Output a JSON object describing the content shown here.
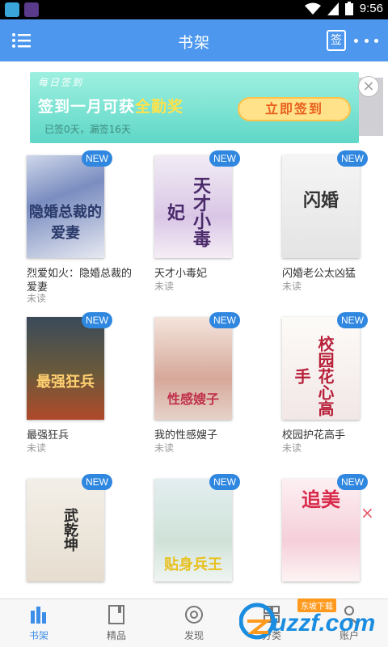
{
  "status_bar": {
    "time": "9:56"
  },
  "header": {
    "title": "书架",
    "sign_icon_label": "签"
  },
  "banner": {
    "heading": "每日签到",
    "main_prefix": "签到一月可获",
    "main_highlight": "全勤奖",
    "button_label": "立即签到",
    "subtext": "已签0天，漏签16天"
  },
  "books": [
    {
      "name": "烈爱如火：隐婚总裁的爱妻",
      "status": "未读",
      "badge": "NEW",
      "cover_text": "隐婚总裁的爱妻"
    },
    {
      "name": "天才小毒妃",
      "status": "未读",
      "badge": "NEW",
      "cover_text": "天才小毒妃"
    },
    {
      "name": "闪婚老公太凶猛",
      "status": "未读",
      "badge": "NEW",
      "cover_text": "闪婚"
    },
    {
      "name": "最强狂兵",
      "status": "未读",
      "badge": "NEW",
      "cover_text": "最强狂兵"
    },
    {
      "name": "我的性感嫂子",
      "status": "未读",
      "badge": "NEW",
      "cover_text": "性感嫂子"
    },
    {
      "name": "校园护花高手",
      "status": "未读",
      "badge": "NEW",
      "cover_text": "校园花心高手"
    },
    {
      "name": "",
      "status": "",
      "badge": "NEW",
      "cover_text": "武乾坤"
    },
    {
      "name": "",
      "status": "",
      "badge": "NEW",
      "cover_text": "贴身兵王"
    },
    {
      "name": "",
      "status": "",
      "badge": "NEW",
      "cover_text": "追美"
    }
  ],
  "bottom_nav": [
    {
      "label": "书架",
      "icon": "bookshelf-icon",
      "active": true
    },
    {
      "label": "精品",
      "icon": "book-icon",
      "active": false
    },
    {
      "label": "发现",
      "icon": "compass-icon",
      "active": false
    },
    {
      "label": "分类",
      "icon": "category-icon",
      "active": false
    },
    {
      "label": "账户",
      "icon": "account-icon",
      "active": false
    }
  ],
  "watermark": {
    "text": "uzzf.com",
    "tag": "东坡下载"
  },
  "colors": {
    "accent": "#4d98ee",
    "badge": "#2f87e0",
    "nav_active": "#3d8ee8"
  }
}
